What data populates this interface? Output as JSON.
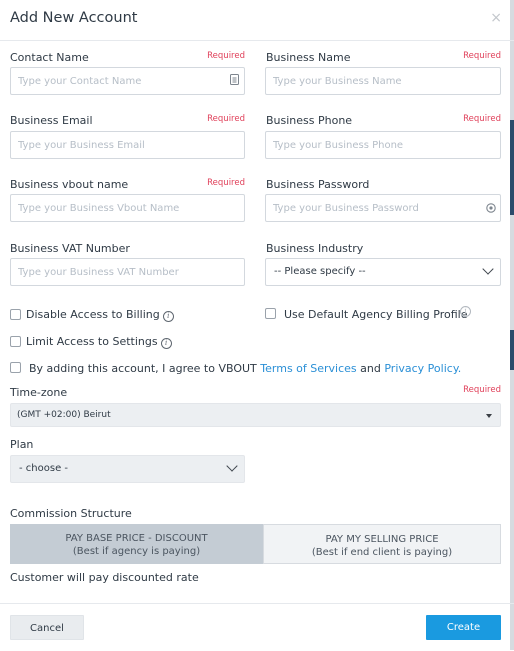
{
  "dialog": {
    "title": "Add New Account",
    "close_glyph": "×"
  },
  "required_text": "Required",
  "fields": {
    "contact_name": {
      "label": "Contact Name",
      "placeholder": "Type your Contact Name"
    },
    "business_name": {
      "label": "Business Name",
      "placeholder": "Type your Business Name"
    },
    "business_email": {
      "label": "Business Email",
      "placeholder": "Type your Business Email"
    },
    "business_phone": {
      "label": "Business Phone",
      "placeholder": "Type your Business Phone"
    },
    "vbout_name": {
      "label": "Business vbout name",
      "placeholder": "Type your Business Vbout Name"
    },
    "business_password": {
      "label": "Business Password",
      "placeholder": "Type your Business Password"
    },
    "vat_number": {
      "label": "Business VAT Number",
      "placeholder": "Type your Business VAT Number"
    },
    "industry": {
      "label": "Business Industry",
      "value": "-- Please specify --"
    },
    "timezone": {
      "label": "Time-zone",
      "value": "(GMT +02:00) Beirut"
    },
    "plan": {
      "label": "Plan",
      "value": "- choose -"
    }
  },
  "checkboxes": {
    "disable_billing": "Disable Access to Billing",
    "default_billing_profile": "Use Default Agency Billing Profile",
    "limit_settings": "Limit Access to Settings",
    "agree_prefix": "By adding this account, I agree to VBOUT",
    "terms_link": "Terms of Services",
    "agree_and": "and",
    "privacy_link": "Privacy Policy",
    "agree_suffix": "."
  },
  "commission": {
    "label": "Commission Structure",
    "option_discount_title": "PAY BASE PRICE - DISCOUNT",
    "option_discount_sub": "(Best if agency is paying)",
    "option_selling_title": "PAY MY SELLING PRICE",
    "option_selling_sub": "(Best if end client is paying)",
    "note": "Customer will pay discounted rate"
  },
  "footer": {
    "cancel_label": "Cancel",
    "create_label": "Create"
  },
  "icons": {
    "info": "i",
    "contact_card": "contact-card-icon",
    "password_eye": "eye-icon"
  },
  "colors": {
    "primary": "#1a9ae0",
    "required": "#e0405a",
    "link": "#2a8fd6",
    "active_segment": "#c4ccd4"
  }
}
